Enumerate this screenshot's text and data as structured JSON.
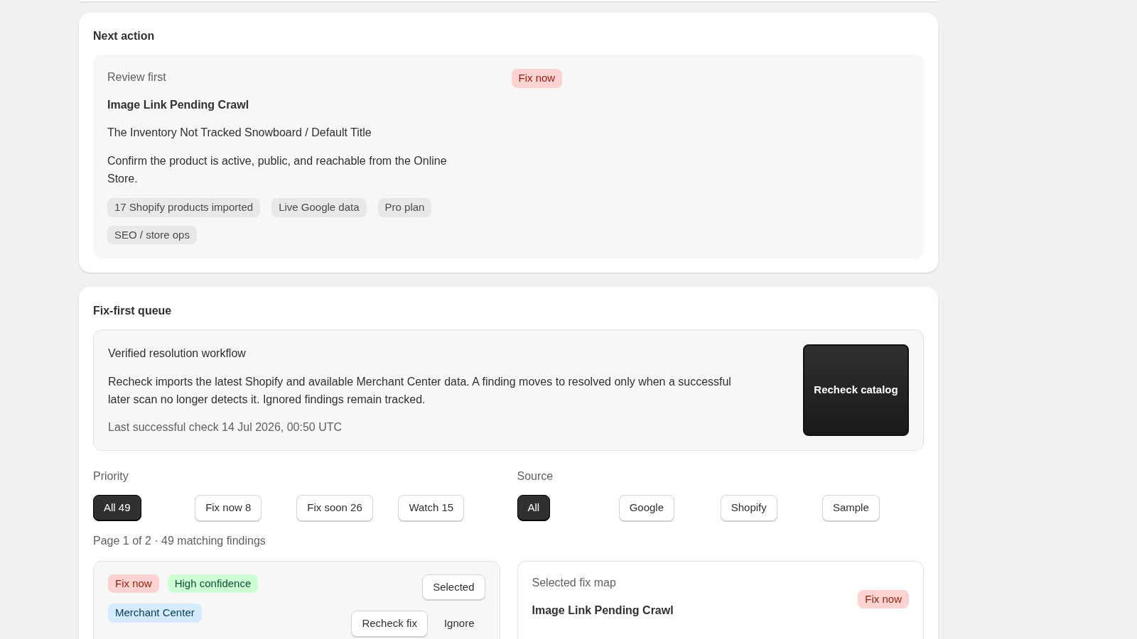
{
  "next_action": {
    "title": "Next action",
    "eyebrow": "Review first",
    "badge": {
      "label": "Fix now",
      "color": "#fed3d1"
    },
    "issue": "Image Link Pending Crawl",
    "product": "The Inventory Not Tracked Snowboard / Default Title",
    "instruction": "Confirm the product is active, public, and reachable from the Online Store.",
    "tags": [
      "17 Shopify products imported",
      "Live Google data",
      "Pro plan",
      "SEO / store ops"
    ]
  },
  "queue": {
    "title": "Fix-first queue",
    "workflow": {
      "title": "Verified resolution workflow",
      "description": "Recheck imports the latest Shopify and available Merchant Center data. A finding moves to resolved only when a successful later scan no longer detects it. Ignored findings remain tracked.",
      "last_check": "Last successful check 14 Jul 2026, 00:50 UTC",
      "button": "Recheck catalog"
    },
    "filters": [
      {
        "label": "Priority",
        "options": [
          {
            "label": "All 49",
            "selected": true
          },
          {
            "label": "Fix now 8",
            "selected": false
          },
          {
            "label": "Fix soon 26",
            "selected": false
          },
          {
            "label": "Watch 15",
            "selected": false
          }
        ]
      },
      {
        "label": "Source",
        "options": [
          {
            "label": "All",
            "selected": true
          },
          {
            "label": "Google",
            "selected": false
          },
          {
            "label": "Shopify",
            "selected": false
          },
          {
            "label": "Sample",
            "selected": false
          }
        ]
      }
    ],
    "page_info": "Page 1 of 2 · 49 matching findings",
    "finding": {
      "badges": [
        {
          "label": "Fix now",
          "color": "#fed3d1"
        },
        {
          "label": "High confidence",
          "color": "#cdfed4"
        },
        {
          "label": "Merchant Center",
          "color": "#d5ebff"
        }
      ],
      "selected": true,
      "select_label": "Selected",
      "actions": [
        {
          "label": "Recheck fix",
          "kind": "outlined"
        },
        {
          "label": "Ignore",
          "kind": "plain"
        }
      ]
    },
    "fix_map": {
      "title": "Selected fix map",
      "issue": "Image Link Pending Crawl",
      "badge": {
        "label": "Fix now",
        "color": "#fed3d1"
      }
    }
  }
}
